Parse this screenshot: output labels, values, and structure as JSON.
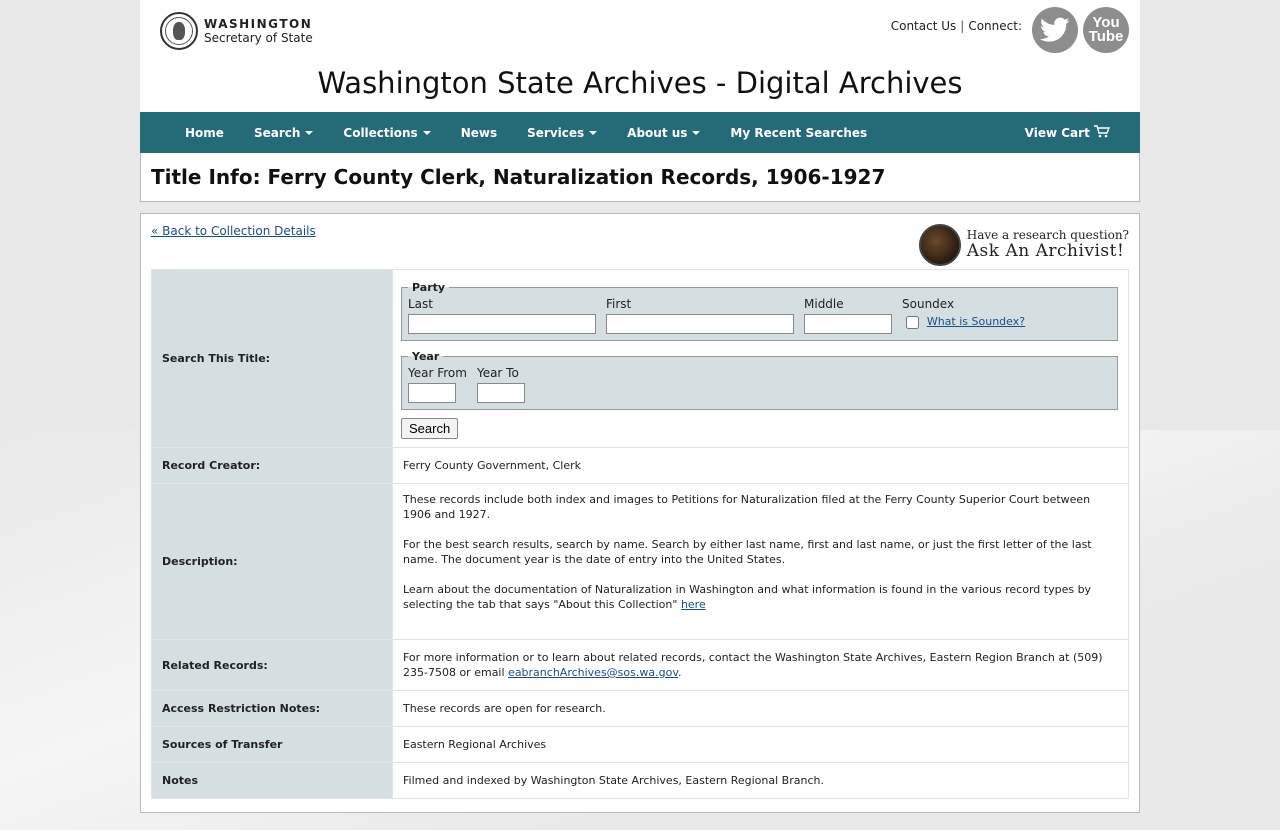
{
  "header": {
    "logo_line1": "WASHINGTON",
    "logo_line2": "Secretary of State",
    "contact_us": "Contact Us",
    "separator": "|",
    "connect": "Connect:",
    "youtube_label": "You Tube",
    "site_title": "Washington State Archives - Digital Archives"
  },
  "nav": {
    "home": "Home",
    "search": "Search",
    "collections": "Collections",
    "news": "News",
    "services": "Services",
    "about": "About us",
    "recent": "My Recent Searches",
    "cart": "View Cart"
  },
  "page_title": "Title Info: Ferry County Clerk, Naturalization Records, 1906-1927",
  "back_link": "« Back to Collection Details",
  "ask": {
    "line1": "Have a research question?",
    "line2": "Ask An Archivist!"
  },
  "search_form": {
    "label": "Search This Title:",
    "party_legend": "Party",
    "last_label": "Last",
    "first_label": "First",
    "middle_label": "Middle",
    "soundex_label": "Soundex",
    "soundex_link": "What is Soundex?",
    "year_legend": "Year",
    "year_from_label": "Year From",
    "year_to_label": "Year To",
    "search_button": "Search"
  },
  "rows": {
    "creator_label": "Record Creator:",
    "creator_value": "Ferry County Government, Clerk",
    "description_label": "Description:",
    "desc_p1": "These records include both index and images to Petitions for Naturalization filed at the Ferry County Superior Court between 1906 and 1927.",
    "desc_p2": "For the best search results, search by name. Search by either last name, first and last name, or just the first letter of the last name. The document year is the date of entry into the United States.",
    "desc_p3": "Learn about the documentation of Naturalization in Washington and what information is found in the various record types by selecting the tab that says \"About this Collection\"",
    "desc_p3_link": "here",
    "related_label": "Related Records:",
    "related_text": "For more information or to learn about related records, contact the Washington State Archives, Eastern Region Branch at (509) 235-7508 or email",
    "related_email": "eabranchArchives@sos.wa.gov",
    "related_end": ".",
    "access_label": "Access Restriction Notes:",
    "access_value": "These records are open for research.",
    "sources_label": "Sources of Transfer",
    "sources_value": "Eastern Regional Archives",
    "notes_label": "Notes",
    "notes_value": "Filmed and indexed by Washington State Archives, Eastern Regional Branch."
  },
  "colors": {
    "nav_bg": "#256a77",
    "label_bg": "#d5dfe1",
    "link": "#1a4e8a"
  }
}
